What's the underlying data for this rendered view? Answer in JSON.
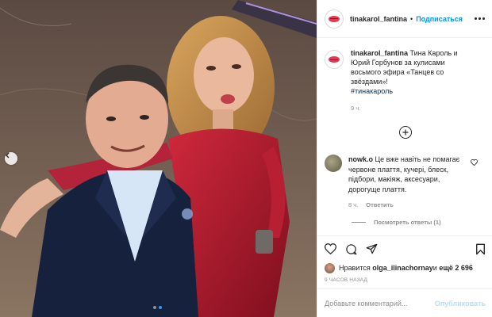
{
  "post": {
    "author": "tinakarol_fantina",
    "separator": "•",
    "follow_label": "Подписаться",
    "more_icon": "more-horizontal-icon"
  },
  "caption": {
    "author": "tinakarol_fantina",
    "text": " Тина Кароль и Юрий Горбунов за кулисами восьмого эфира «Танцев со звёздами»!",
    "hashtag": "#тинакароль",
    "time": "9 ч."
  },
  "load_more_icon": "plus-circle-icon",
  "comment": {
    "author": "nowk.o",
    "text": " Це вже навіть не помагає червоне плаття, кучері, блеск, підбори, макіяж, аксесуари, дорогуще плаття.",
    "time": "8 ч.",
    "reply_label": "Ответить",
    "view_replies": "Посмотреть ответы (1)"
  },
  "likes": {
    "prefix": "Нравится ",
    "user": "olga_ilinachornay",
    "middle": " и ",
    "count": "ещё 2 696"
  },
  "posted_ago": "9 ЧАСОВ НАЗАД",
  "add_comment": {
    "placeholder": "Добавьте комментарий...",
    "publish_label": "Опубликовать"
  },
  "colors": {
    "accent": "#0095f6",
    "publish_disabled": "#b2dffc",
    "muted": "#8e8e8e",
    "carousel_active": "#3897f0"
  },
  "carousel": {
    "total": 2,
    "active_index": 1
  }
}
